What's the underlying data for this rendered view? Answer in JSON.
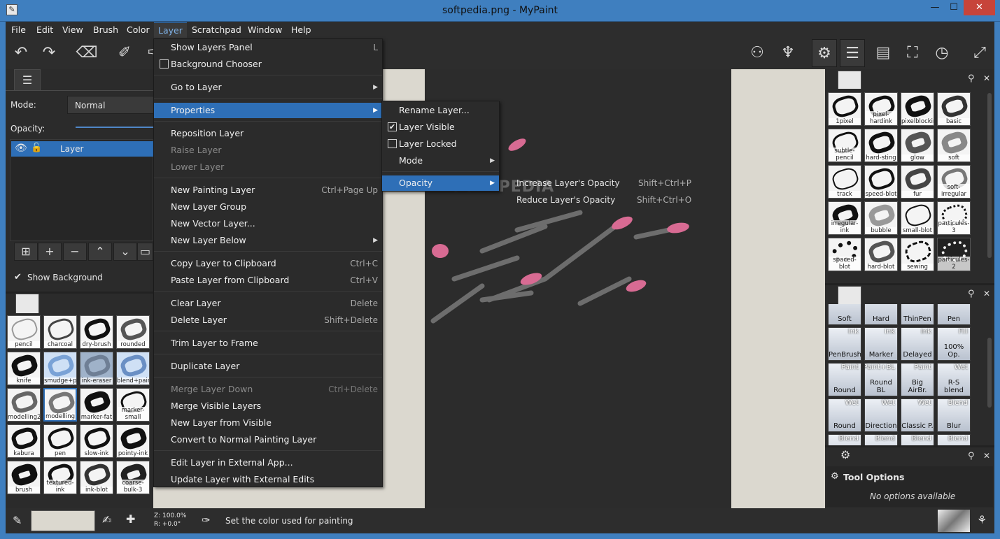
{
  "window": {
    "title": "softpedia.png - MyPaint",
    "minimize": "—",
    "maximize": "☐",
    "close": "✕"
  },
  "menubar": [
    "File",
    "Edit",
    "View",
    "Brush",
    "Color",
    "Layer",
    "Scratchpad",
    "Window",
    "Help"
  ],
  "layers_panel": {
    "mode_label": "Mode:",
    "mode_value": "Normal",
    "opacity_label": "Opacity:",
    "layer_name": "Layer",
    "show_background": "Show Background"
  },
  "layer_menu": {
    "items": [
      {
        "label": "Show Layers Panel",
        "shortcut": "L"
      },
      {
        "label": "Background Chooser"
      },
      {
        "label": "Go to Layer"
      },
      {
        "label": "Properties"
      },
      {
        "label": "Reposition Layer"
      },
      {
        "label": "Raise Layer"
      },
      {
        "label": "Lower Layer"
      },
      {
        "label": "New Painting Layer",
        "shortcut": "Ctrl+Page Up"
      },
      {
        "label": "New Layer Group"
      },
      {
        "label": "New Vector Layer..."
      },
      {
        "label": "New Layer Below"
      },
      {
        "label": "Copy Layer to Clipboard",
        "shortcut": "Ctrl+C"
      },
      {
        "label": "Paste Layer from Clipboard",
        "shortcut": "Ctrl+V"
      },
      {
        "label": "Clear Layer",
        "shortcut": "Delete"
      },
      {
        "label": "Delete Layer",
        "shortcut": "Shift+Delete"
      },
      {
        "label": "Trim Layer to Frame"
      },
      {
        "label": "Duplicate Layer"
      },
      {
        "label": "Merge Layer Down",
        "shortcut": "Ctrl+Delete"
      },
      {
        "label": "Merge Visible Layers"
      },
      {
        "label": "New Layer from Visible"
      },
      {
        "label": "Convert to Normal Painting Layer"
      },
      {
        "label": "Edit Layer in External App..."
      },
      {
        "label": "Update Layer with External Edits"
      }
    ]
  },
  "properties_submenu": [
    "Rename Layer...",
    "Layer Visible",
    "Layer Locked",
    "Mode",
    "Opacity"
  ],
  "opacity_submenu": [
    {
      "label": "Increase Layer's Opacity",
      "shortcut": "Shift+Ctrl+P"
    },
    {
      "label": "Reduce Layer's Opacity",
      "shortcut": "Shift+Ctrl+O"
    }
  ],
  "canvas": {
    "watermark": "SOFTPEDIA"
  },
  "left_brushes": [
    "pencil",
    "charcoal",
    "dry-brush",
    "rounded",
    "knife",
    "smudge+paint",
    "ink-eraser",
    "blend+paint",
    "modelling2",
    "modelling",
    "marker-fat",
    "marker-small",
    "kabura",
    "pen",
    "slow-ink",
    "pointy-ink",
    "brush",
    "textured-ink",
    "ink-blot",
    "coarse-bulk-3"
  ],
  "right_brushes": [
    "1pixel",
    "pixel-hardink",
    "pixelblocking",
    "basic",
    "subtle-pencil",
    "hard-sting",
    "glow",
    "soft",
    "track",
    "speed-blot",
    "fur",
    "soft-irregular",
    "irregular-ink",
    "bubble",
    "small-blot",
    "particules-3",
    "spaced-blot",
    "hard-blot",
    "sewing",
    "particules-2"
  ],
  "basic_set": [
    {
      "top": "",
      "label": "Soft"
    },
    {
      "top": "",
      "label": "Hard"
    },
    {
      "top": "",
      "label": "ThinPen"
    },
    {
      "top": "",
      "label": "Pen"
    },
    {
      "top": "Ink",
      "label": "PenBrush"
    },
    {
      "top": "Ink",
      "label": "Marker"
    },
    {
      "top": "Ink",
      "label": "Delayed"
    },
    {
      "top": "Fill",
      "label": "100% Op."
    },
    {
      "top": "Paint",
      "label": "Round"
    },
    {
      "top": "Paint+BL",
      "label": "Round BL"
    },
    {
      "top": "Paint",
      "label": "Big AirBr."
    },
    {
      "top": "Wet",
      "label": "R-S blend"
    },
    {
      "top": "Wet",
      "label": "Round"
    },
    {
      "top": "Wet",
      "label": "Direction"
    },
    {
      "top": "Wet",
      "label": "Classic P."
    },
    {
      "top": "Blend",
      "label": "Blur"
    },
    {
      "top": "Blend",
      "label": ""
    },
    {
      "top": "Blend",
      "label": ""
    },
    {
      "top": "Blend",
      "label": ""
    },
    {
      "top": "Blend",
      "label": ""
    }
  ],
  "tool_options": {
    "title": "Tool Options",
    "message": "No options available"
  },
  "statusbar": {
    "zoom": "Z: 100.0%",
    "rotation": "R: +0.0°",
    "message": "Set the color used for painting"
  }
}
